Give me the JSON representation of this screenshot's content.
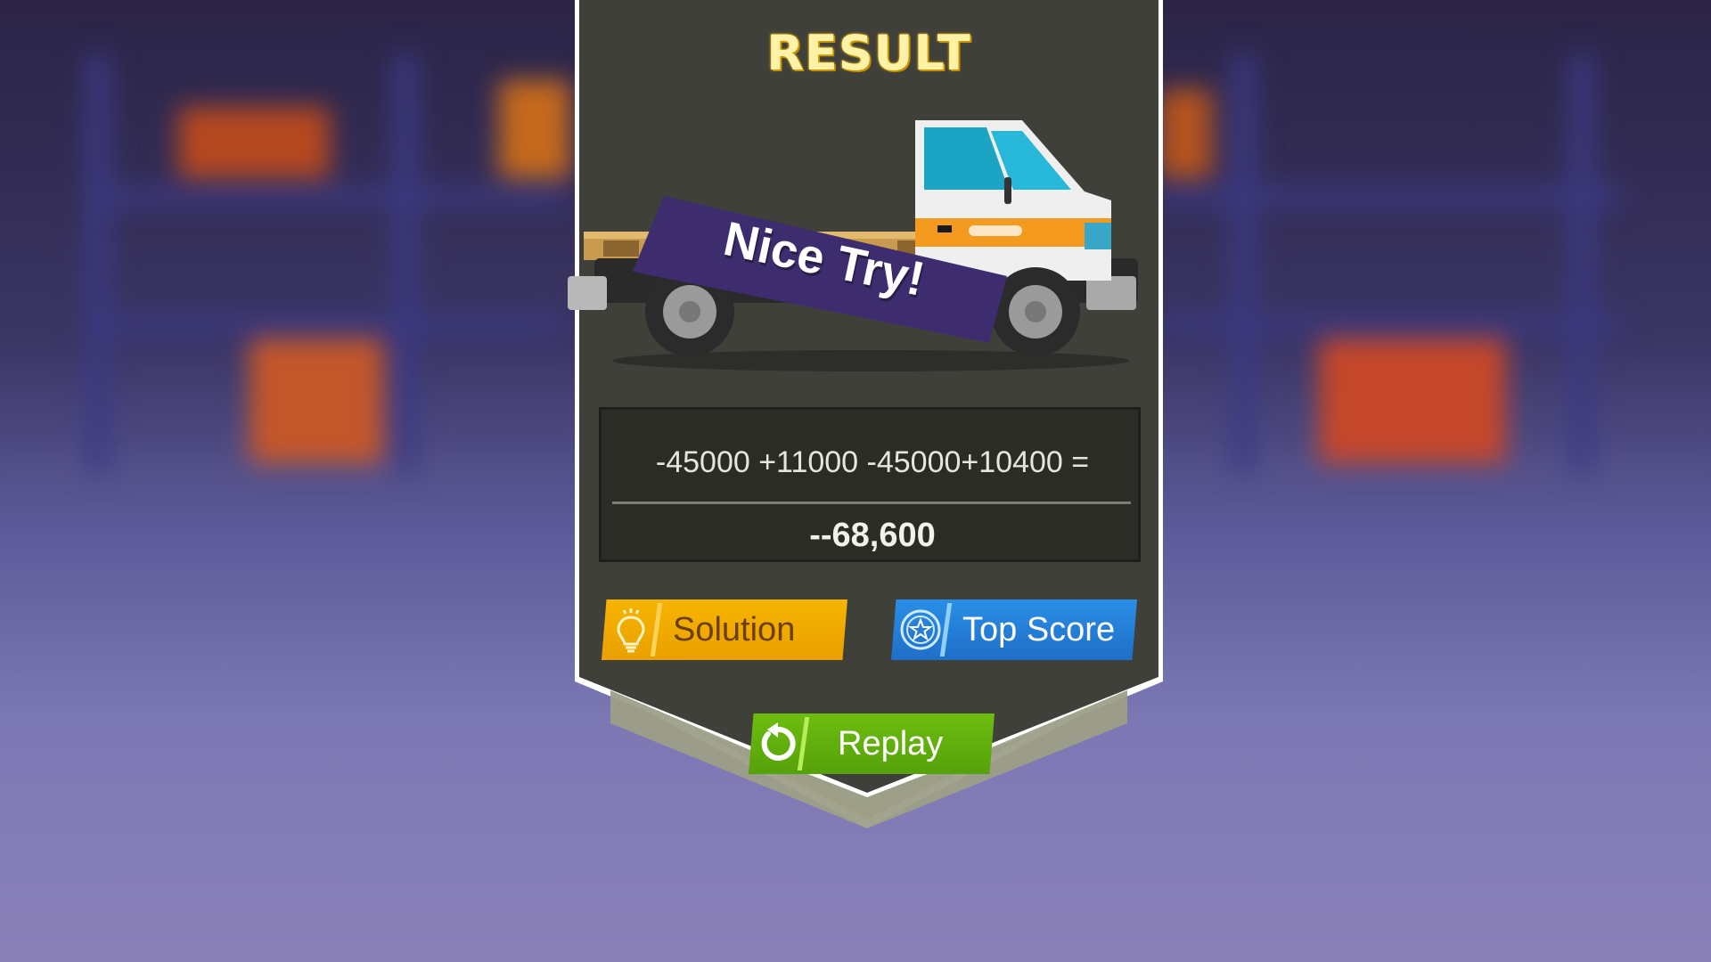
{
  "result": {
    "title": "RESULT",
    "banner_text": "Nice Try!",
    "equation": "-45000 +11000 -45000+10400 =",
    "answer": "--68,600"
  },
  "buttons": {
    "solution_label": "Solution",
    "top_score_label": "Top Score",
    "replay_label": "Replay"
  },
  "icons": {
    "solution": "lightbulb-icon",
    "top_score": "star-badge-icon",
    "replay": "replay-arrow-icon"
  },
  "colors": {
    "panel": "#40403a",
    "title": "#fff2a6",
    "banner": "#3e2d6e",
    "solution": "#f2a900",
    "top_score": "#2a82dc",
    "replay": "#62b10d"
  }
}
